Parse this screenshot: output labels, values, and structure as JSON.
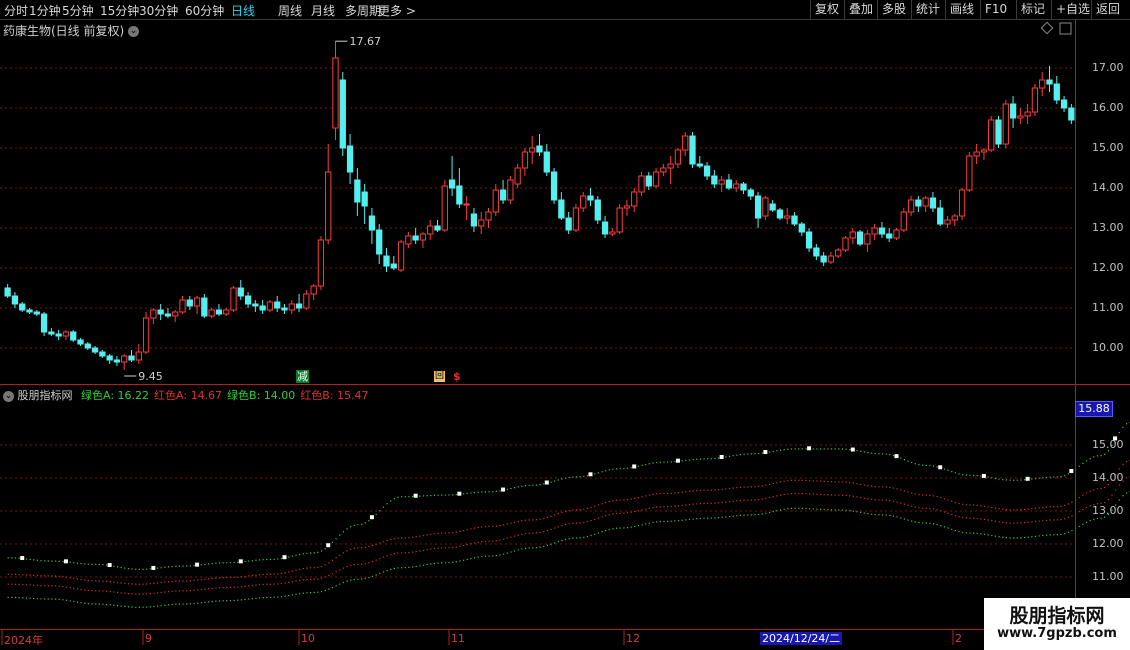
{
  "toolbar": {
    "periods": [
      {
        "label": "分时"
      },
      {
        "label": "1分钟"
      },
      {
        "label": "5分钟"
      },
      {
        "label": "15分钟"
      },
      {
        "label": "30分钟"
      },
      {
        "label": "60分钟"
      },
      {
        "label": "日线",
        "active": true
      },
      {
        "label": "周线"
      },
      {
        "label": "月线"
      },
      {
        "label": "多周期"
      },
      {
        "label": "更多 >"
      }
    ],
    "right_buttons": [
      {
        "label": "复权"
      },
      {
        "label": "叠加"
      },
      {
        "label": "多股"
      },
      {
        "label": "统计"
      },
      {
        "label": "画线"
      },
      {
        "label": "F10"
      },
      {
        "label": "标记"
      },
      {
        "label": "+自选"
      },
      {
        "label": "返回"
      }
    ]
  },
  "main": {
    "title": "药康生物(日线 前复权)",
    "high_label": "17.67",
    "low_label": "9.45",
    "markers": [
      "减",
      "回",
      "$"
    ],
    "y_labels": [
      "17.00",
      "16.00",
      "15.00",
      "14.00",
      "13.00",
      "12.00",
      "11.00",
      "10.00"
    ]
  },
  "sub": {
    "title": "股朋指标网",
    "legend": [
      {
        "name": "绿色A",
        "value": "16.22",
        "color": "#2fd12f"
      },
      {
        "name": "红色A",
        "value": "14.67",
        "color": "#e03030"
      },
      {
        "name": "绿色B",
        "value": "14.00",
        "color": "#2fd12f"
      },
      {
        "name": "红色B",
        "value": "15.47",
        "color": "#e03030"
      }
    ],
    "current_value": "15.88",
    "y_labels": [
      "15.00",
      "14.00",
      "13.00",
      "12.00",
      "11.00"
    ]
  },
  "x_axis": {
    "labels": [
      "2024年",
      "9",
      "10",
      "11",
      "12",
      "2024/12/24/二",
      "2"
    ]
  },
  "watermark": {
    "line1": "股朋指标网",
    "line2": "www.7gpzb.com"
  },
  "colors": {
    "up": "#ff3c3c",
    "down": "#54f0f0",
    "grid": "#7a1414",
    "axis": "#b02020"
  },
  "chart_data": [
    {
      "type": "candlestick",
      "title": "药康生物(日线 前复权)",
      "ylim": [
        9.2,
        17.9
      ],
      "annotations": [
        {
          "label": "17.67",
          "kind": "high"
        },
        {
          "label": "9.45",
          "kind": "low"
        }
      ],
      "ohlc": [
        [
          11.5,
          11.6,
          11.25,
          11.3
        ],
        [
          11.3,
          11.4,
          11.0,
          11.1
        ],
        [
          11.1,
          11.15,
          10.9,
          10.95
        ],
        [
          10.95,
          11.0,
          10.85,
          10.9
        ],
        [
          10.9,
          10.95,
          10.8,
          10.85
        ],
        [
          10.85,
          10.9,
          10.3,
          10.4
        ],
        [
          10.4,
          10.5,
          10.3,
          10.35
        ],
        [
          10.35,
          10.45,
          10.2,
          10.3
        ],
        [
          10.3,
          10.45,
          10.2,
          10.4
        ],
        [
          10.4,
          10.45,
          10.15,
          10.2
        ],
        [
          10.2,
          10.25,
          10.05,
          10.1
        ],
        [
          10.1,
          10.15,
          9.95,
          10.0
        ],
        [
          10.0,
          10.05,
          9.85,
          9.9
        ],
        [
          9.9,
          9.95,
          9.75,
          9.8
        ],
        [
          9.8,
          9.85,
          9.6,
          9.7
        ],
        [
          9.7,
          9.8,
          9.55,
          9.65
        ],
        [
          9.65,
          9.85,
          9.45,
          9.8
        ],
        [
          9.8,
          9.95,
          9.65,
          9.7
        ],
        [
          9.7,
          10.1,
          9.6,
          9.9
        ],
        [
          9.9,
          10.9,
          9.85,
          10.75
        ],
        [
          10.75,
          11.0,
          10.6,
          10.95
        ],
        [
          10.95,
          11.1,
          10.7,
          10.85
        ],
        [
          10.85,
          11.0,
          10.75,
          10.8
        ],
        [
          10.8,
          10.95,
          10.65,
          10.9
        ],
        [
          10.9,
          11.3,
          10.85,
          11.2
        ],
        [
          11.2,
          11.3,
          10.95,
          11.05
        ],
        [
          11.05,
          11.3,
          10.85,
          11.25
        ],
        [
          11.25,
          11.35,
          10.75,
          10.8
        ],
        [
          10.8,
          11.0,
          10.75,
          10.95
        ],
        [
          10.95,
          11.1,
          10.8,
          10.85
        ],
        [
          10.85,
          11.0,
          10.8,
          10.95
        ],
        [
          10.95,
          11.55,
          10.9,
          11.5
        ],
        [
          11.5,
          11.7,
          11.2,
          11.3
        ],
        [
          11.3,
          11.4,
          11.0,
          11.1
        ],
        [
          11.1,
          11.2,
          10.9,
          11.05
        ],
        [
          11.05,
          11.2,
          10.85,
          10.95
        ],
        [
          10.95,
          11.2,
          10.9,
          11.15
        ],
        [
          11.15,
          11.3,
          10.9,
          11.0
        ],
        [
          11.0,
          11.1,
          10.85,
          10.95
        ],
        [
          10.95,
          11.2,
          10.85,
          11.1
        ],
        [
          11.1,
          11.35,
          10.9,
          11.0
        ],
        [
          11.0,
          11.45,
          10.95,
          11.35
        ],
        [
          11.35,
          11.6,
          11.2,
          11.55
        ],
        [
          11.55,
          12.8,
          11.45,
          12.7
        ],
        [
          12.7,
          15.1,
          12.6,
          14.4
        ],
        [
          15.5,
          17.67,
          15.2,
          17.25
        ],
        [
          16.7,
          16.9,
          14.8,
          15.0
        ],
        [
          15.05,
          15.35,
          14.1,
          14.4
        ],
        [
          14.2,
          14.5,
          13.3,
          13.65
        ],
        [
          13.9,
          14.1,
          13.1,
          13.55
        ],
        [
          13.3,
          13.5,
          12.6,
          12.95
        ],
        [
          12.95,
          13.1,
          12.1,
          12.35
        ],
        [
          12.3,
          12.5,
          11.9,
          12.05
        ],
        [
          12.1,
          12.3,
          11.95,
          12.0
        ],
        [
          11.95,
          12.7,
          11.9,
          12.65
        ],
        [
          12.6,
          12.9,
          12.5,
          12.8
        ],
        [
          12.8,
          13.0,
          12.6,
          12.7
        ],
        [
          12.7,
          12.9,
          12.5,
          12.85
        ],
        [
          12.85,
          13.2,
          12.7,
          13.05
        ],
        [
          13.05,
          13.2,
          12.9,
          12.95
        ],
        [
          12.95,
          14.2,
          12.9,
          14.05
        ],
        [
          14.2,
          14.8,
          13.8,
          14.0
        ],
        [
          14.05,
          14.5,
          13.5,
          13.6
        ],
        [
          13.6,
          13.8,
          13.2,
          13.6
        ],
        [
          13.35,
          13.5,
          12.9,
          13.05
        ],
        [
          13.05,
          13.4,
          12.85,
          13.2
        ],
        [
          13.2,
          13.5,
          13.0,
          13.4
        ],
        [
          13.4,
          14.1,
          13.3,
          13.95
        ],
        [
          13.95,
          14.2,
          13.6,
          13.7
        ],
        [
          13.7,
          14.3,
          13.6,
          14.2
        ],
        [
          14.1,
          14.6,
          14.0,
          14.5
        ],
        [
          14.5,
          15.0,
          14.3,
          14.9
        ],
        [
          14.9,
          15.3,
          14.6,
          15.0
        ],
        [
          15.05,
          15.35,
          14.8,
          14.9
        ],
        [
          14.9,
          15.1,
          14.3,
          14.4
        ],
        [
          14.4,
          14.5,
          13.6,
          13.7
        ],
        [
          13.7,
          13.9,
          13.2,
          13.25
        ],
        [
          13.25,
          13.4,
          12.85,
          12.95
        ],
        [
          12.95,
          13.6,
          12.9,
          13.5
        ],
        [
          13.5,
          13.9,
          13.4,
          13.8
        ],
        [
          13.8,
          14.0,
          13.55,
          13.7
        ],
        [
          13.7,
          13.8,
          13.1,
          13.2
        ],
        [
          13.15,
          13.3,
          12.75,
          12.85
        ],
        [
          12.85,
          13.0,
          12.8,
          12.9
        ],
        [
          12.9,
          13.6,
          12.85,
          13.5
        ],
        [
          13.5,
          13.7,
          13.3,
          13.55
        ],
        [
          13.55,
          14.0,
          13.4,
          13.9
        ],
        [
          13.9,
          14.4,
          13.8,
          14.3
        ],
        [
          14.3,
          14.4,
          13.95,
          14.05
        ],
        [
          14.05,
          14.5,
          14.0,
          14.4
        ],
        [
          14.4,
          14.6,
          14.3,
          14.5
        ],
        [
          14.5,
          14.8,
          14.1,
          14.6
        ],
        [
          14.6,
          15.0,
          14.5,
          14.95
        ],
        [
          14.95,
          15.4,
          14.8,
          15.3
        ],
        [
          15.3,
          15.4,
          14.5,
          14.6
        ],
        [
          14.6,
          14.8,
          14.5,
          14.55
        ],
        [
          14.55,
          14.65,
          14.2,
          14.3
        ],
        [
          14.3,
          14.45,
          14.0,
          14.1
        ],
        [
          14.1,
          14.3,
          13.9,
          14.2
        ],
        [
          14.2,
          14.35,
          13.95,
          14.0
        ],
        [
          14.0,
          14.2,
          13.9,
          14.1
        ],
        [
          14.1,
          14.15,
          13.85,
          13.95
        ],
        [
          13.95,
          14.0,
          13.7,
          13.8
        ],
        [
          13.8,
          13.9,
          13.0,
          13.25
        ],
        [
          13.3,
          13.8,
          13.2,
          13.75
        ],
        [
          13.6,
          13.7,
          13.4,
          13.45
        ],
        [
          13.45,
          13.5,
          13.2,
          13.25
        ],
        [
          13.25,
          13.5,
          13.1,
          13.3
        ],
        [
          13.3,
          13.4,
          13.05,
          13.1
        ],
        [
          13.1,
          13.15,
          12.8,
          12.9
        ],
        [
          12.9,
          13.0,
          12.4,
          12.5
        ],
        [
          12.5,
          12.6,
          12.2,
          12.3
        ],
        [
          12.3,
          12.4,
          12.05,
          12.15
        ],
        [
          12.15,
          12.4,
          12.1,
          12.3
        ],
        [
          12.3,
          12.5,
          12.25,
          12.45
        ],
        [
          12.45,
          12.8,
          12.4,
          12.75
        ],
        [
          12.75,
          13.0,
          12.6,
          12.9
        ],
        [
          12.9,
          12.95,
          12.55,
          12.6
        ],
        [
          12.6,
          12.95,
          12.4,
          12.85
        ],
        [
          12.85,
          13.1,
          12.7,
          13.0
        ],
        [
          13.0,
          13.15,
          12.75,
          12.85
        ],
        [
          12.85,
          13.0,
          12.65,
          12.75
        ],
        [
          12.75,
          13.0,
          12.7,
          12.95
        ],
        [
          12.95,
          13.5,
          12.9,
          13.4
        ],
        [
          13.4,
          13.8,
          13.3,
          13.7
        ],
        [
          13.7,
          13.8,
          13.4,
          13.55
        ],
        [
          13.55,
          13.8,
          13.4,
          13.75
        ],
        [
          13.75,
          13.9,
          13.4,
          13.5
        ],
        [
          13.5,
          13.7,
          13.05,
          13.1
        ],
        [
          13.1,
          13.3,
          13.0,
          13.2
        ],
        [
          13.2,
          13.35,
          13.05,
          13.3
        ],
        [
          13.3,
          14.0,
          13.2,
          13.95
        ],
        [
          13.95,
          14.9,
          13.9,
          14.8
        ],
        [
          14.8,
          15.1,
          14.6,
          14.9
        ],
        [
          14.9,
          15.0,
          14.7,
          14.95
        ],
        [
          14.95,
          15.8,
          14.9,
          15.7
        ],
        [
          15.7,
          15.8,
          15.0,
          15.1
        ],
        [
          15.1,
          16.2,
          15.0,
          16.1
        ],
        [
          16.1,
          16.3,
          15.5,
          15.75
        ],
        [
          15.75,
          16.0,
          15.6,
          15.8
        ],
        [
          15.8,
          16.1,
          15.6,
          15.9
        ],
        [
          15.9,
          16.6,
          15.8,
          16.5
        ],
        [
          16.5,
          16.9,
          16.3,
          16.7
        ],
        [
          16.7,
          17.05,
          16.4,
          16.6
        ],
        [
          16.6,
          16.8,
          16.1,
          16.2
        ],
        [
          16.2,
          16.3,
          15.9,
          16.0
        ],
        [
          16.0,
          16.1,
          15.6,
          15.7
        ]
      ]
    },
    {
      "type": "line",
      "title": "股朋指标网",
      "ylim": [
        10.3,
        16.2
      ],
      "x": [
        0,
        6,
        12,
        18,
        24,
        30,
        36,
        42,
        48,
        54,
        60,
        66,
        72,
        78,
        84,
        90,
        96,
        102,
        108,
        114,
        120,
        126,
        132,
        138,
        144,
        150,
        154
      ],
      "series": [
        {
          "name": "绿色A",
          "style": "white-square-dotted",
          "values": [
            11.6,
            11.5,
            11.4,
            11.25,
            11.35,
            11.45,
            11.55,
            11.75,
            12.6,
            13.45,
            13.5,
            13.6,
            13.8,
            14.05,
            14.3,
            14.5,
            14.6,
            14.75,
            14.9,
            14.9,
            14.75,
            14.4,
            14.1,
            13.95,
            14.05,
            14.7,
            15.7
          ]
        },
        {
          "name": "红色B",
          "style": "dotted",
          "values": [
            11.1,
            11.05,
            10.9,
            10.8,
            10.9,
            11.0,
            11.1,
            11.3,
            11.9,
            12.2,
            12.35,
            12.55,
            12.75,
            13.05,
            13.35,
            13.55,
            13.65,
            13.75,
            13.95,
            13.9,
            13.75,
            13.5,
            13.2,
            13.05,
            13.15,
            13.7,
            14.55
          ]
        },
        {
          "name": "红色A",
          "style": "dotted",
          "values": [
            10.8,
            10.75,
            10.6,
            10.5,
            10.6,
            10.7,
            10.8,
            10.95,
            11.4,
            11.75,
            11.9,
            12.1,
            12.35,
            12.65,
            12.95,
            13.15,
            13.25,
            13.35,
            13.55,
            13.5,
            13.35,
            13.1,
            12.8,
            12.65,
            12.75,
            13.25,
            14.05
          ]
        },
        {
          "name": "绿色B",
          "style": "dotted",
          "values": [
            10.4,
            10.35,
            10.2,
            10.1,
            10.2,
            10.3,
            10.4,
            10.55,
            10.95,
            11.3,
            11.45,
            11.65,
            11.9,
            12.2,
            12.5,
            12.7,
            12.8,
            12.9,
            13.1,
            13.05,
            12.9,
            12.65,
            12.35,
            12.2,
            12.3,
            12.8,
            13.6
          ]
        }
      ]
    }
  ]
}
